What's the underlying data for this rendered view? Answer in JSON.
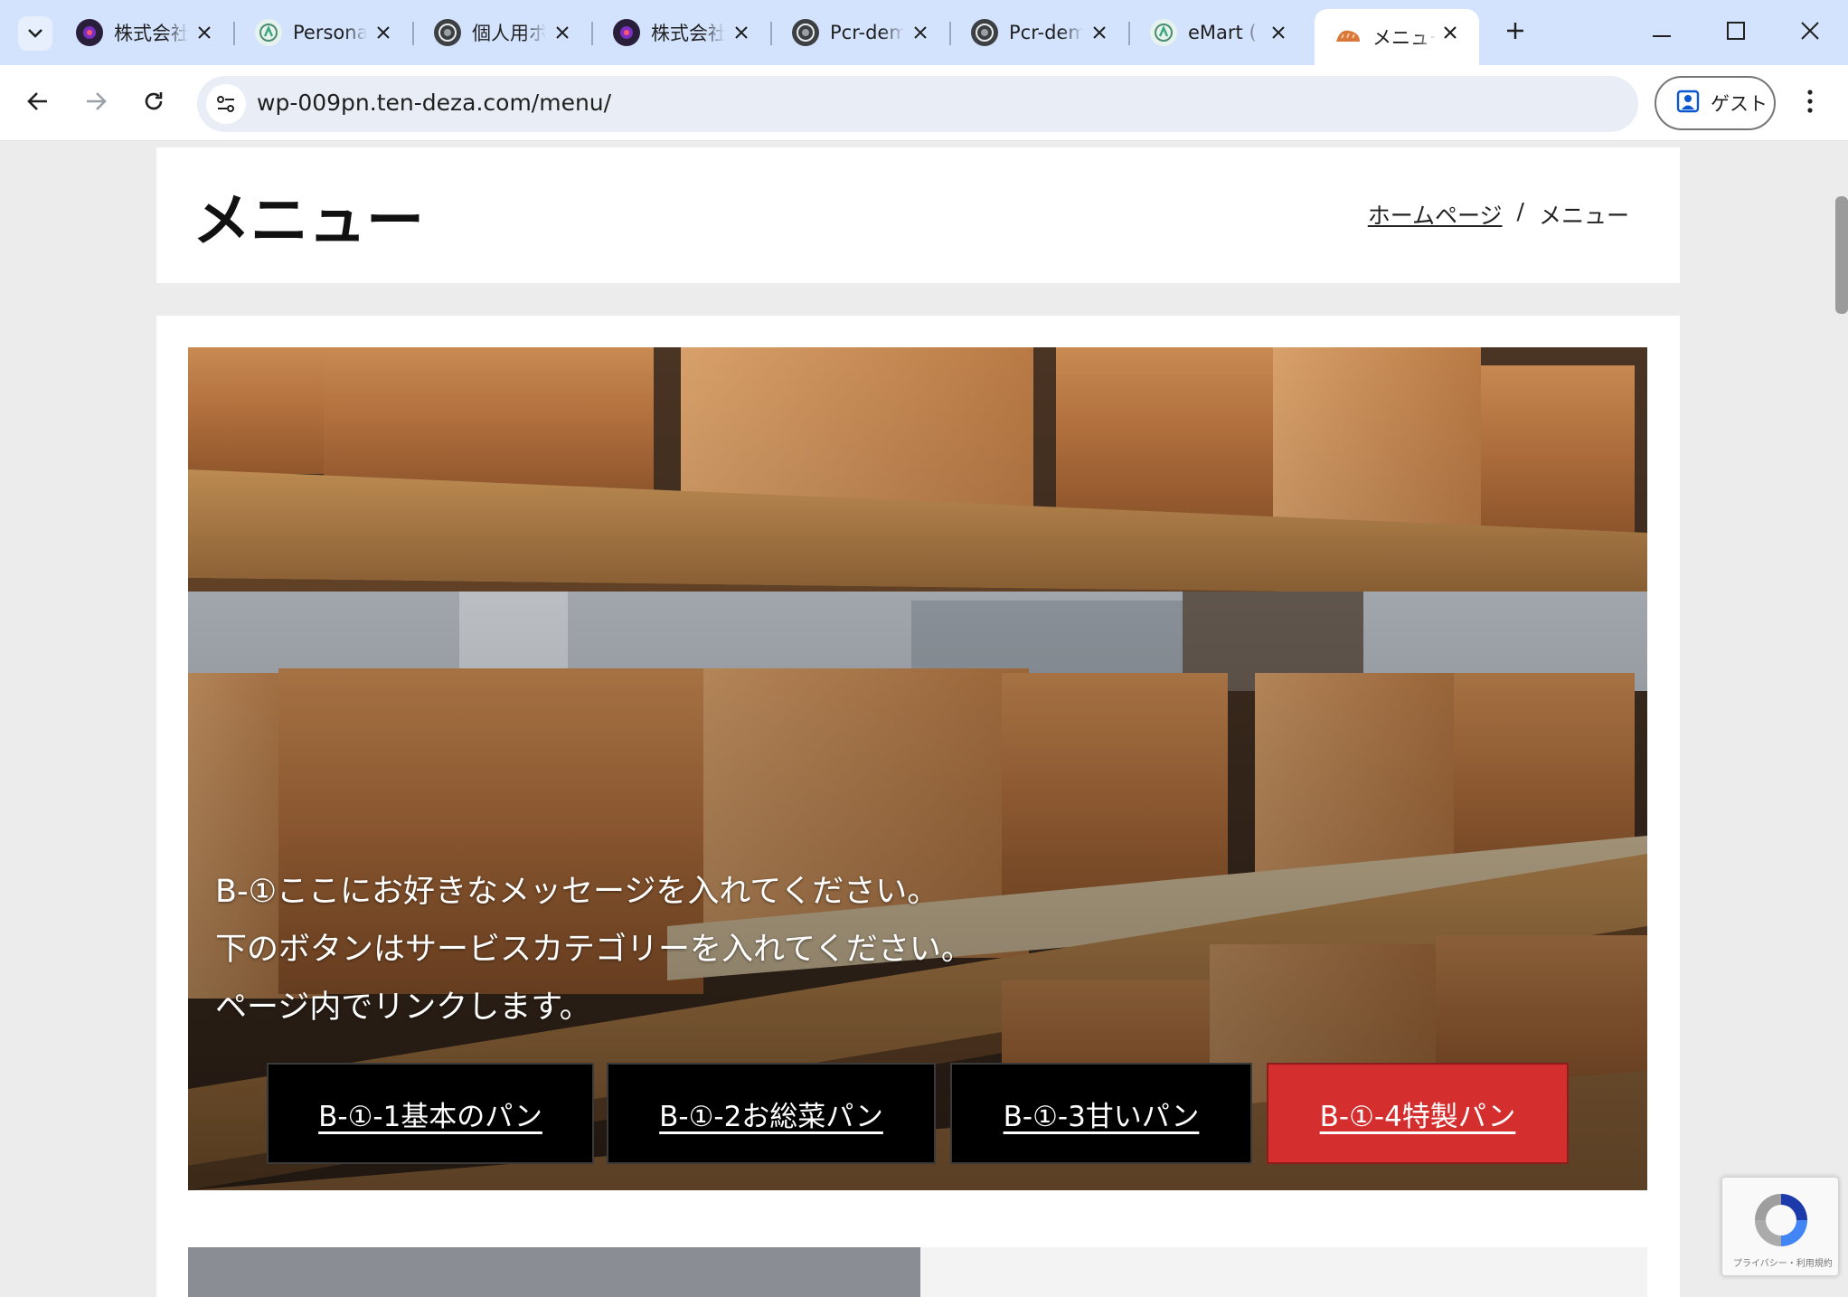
{
  "browser": {
    "tabs": [
      {
        "title": "株式会社",
        "favicon": "dark-logo-icon"
      },
      {
        "title": "Personal",
        "favicon": "green-logo-icon"
      },
      {
        "title": "個人用ポ",
        "favicon": "globe-icon"
      },
      {
        "title": "株式会社",
        "favicon": "dark-logo-icon"
      },
      {
        "title": "Pcr-demo",
        "favicon": "globe-icon"
      },
      {
        "title": "Pcr-demo",
        "favicon": "globe-icon"
      },
      {
        "title": "eMart (",
        "favicon": "green-logo-icon"
      },
      {
        "title": "メニュー",
        "favicon": "bread-icon",
        "active": true
      }
    ],
    "url": "wp-009pn.ten-deza.com/menu/",
    "guest_label": "ゲスト"
  },
  "page": {
    "title": "メニュー",
    "breadcrumb": {
      "home": "ホームページ",
      "separator": "/",
      "current": "メニュー"
    }
  },
  "hero": {
    "message_lines": [
      "B-①ここにお好きなメッセージを入れてください。",
      "下のボタンはサービスカテゴリーを入れてください。",
      "ページ内でリンクします。"
    ],
    "buttons": [
      {
        "label": "B-①-1基本のパン"
      },
      {
        "label": "B-①-2お総菜パン"
      },
      {
        "label": "B-①-3甘いパン"
      },
      {
        "label": "B-①-4特製パン",
        "highlight": true
      }
    ]
  },
  "recaptcha": {
    "text": "プライバシー・利用規約"
  },
  "colors": {
    "accent_red": "#d42e2e",
    "tab_strip": "#d3e3fd",
    "omnibox": "#e9eef6"
  }
}
